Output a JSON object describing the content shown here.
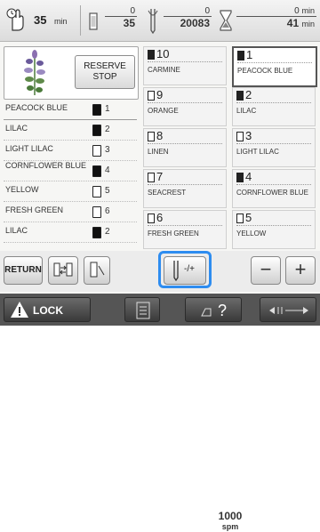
{
  "status": {
    "time_value": "35",
    "time_unit": "min",
    "stitch_color_current": "0",
    "stitch_color_total": "35",
    "stitch_count_current": "0",
    "stitch_count_total": "20083",
    "remaining_time_current": "0",
    "remaining_time_total": "41",
    "remaining_unit_top": "min",
    "remaining_unit_bottom": "min"
  },
  "preview": {
    "reserve_line1": "RESERVE",
    "reserve_line2": "STOP"
  },
  "color_list": [
    {
      "name": "PEACOCK BLUE",
      "num": "1",
      "filled": true
    },
    {
      "name": "LILAC",
      "num": "2",
      "filled": true
    },
    {
      "name": "LIGHT LILAC",
      "num": "3",
      "filled": false
    },
    {
      "name": "CORNFLOWER BLUE",
      "num": "4",
      "filled": true
    },
    {
      "name": "YELLOW",
      "num": "5",
      "filled": false
    },
    {
      "name": "FRESH GREEN",
      "num": "6",
      "filled": false
    },
    {
      "name": "LILAC",
      "num": "2",
      "filled": true
    }
  ],
  "thread_grid": [
    {
      "num": "10",
      "name": "CARMINE",
      "filled": true,
      "selected": false
    },
    {
      "num": "1",
      "name": "PEACOCK BLUE",
      "filled": true,
      "selected": true
    },
    {
      "num": "9",
      "name": "ORANGE",
      "filled": false,
      "selected": false
    },
    {
      "num": "2",
      "name": "LILAC",
      "filled": true,
      "selected": false
    },
    {
      "num": "8",
      "name": "LINEN",
      "filled": false,
      "selected": false
    },
    {
      "num": "3",
      "name": "LIGHT LILAC",
      "filled": false,
      "selected": false
    },
    {
      "num": "7",
      "name": "SEACREST",
      "filled": false,
      "selected": false
    },
    {
      "num": "4",
      "name": "CORNFLOWER BLUE",
      "filled": true,
      "selected": false
    },
    {
      "num": "6",
      "name": "FRESH GREEN",
      "filled": false,
      "selected": false
    },
    {
      "num": "5",
      "name": "YELLOW",
      "filled": false,
      "selected": false
    }
  ],
  "buttons": {
    "return_label": "RETURN",
    "needle_label": "-/+",
    "speed_value": "1000",
    "speed_unit": "spm",
    "minus_label": "−",
    "plus_label": "+",
    "lock_label": "LOCK"
  },
  "icons": {
    "focus_ring_color": "#2d8cf0"
  }
}
